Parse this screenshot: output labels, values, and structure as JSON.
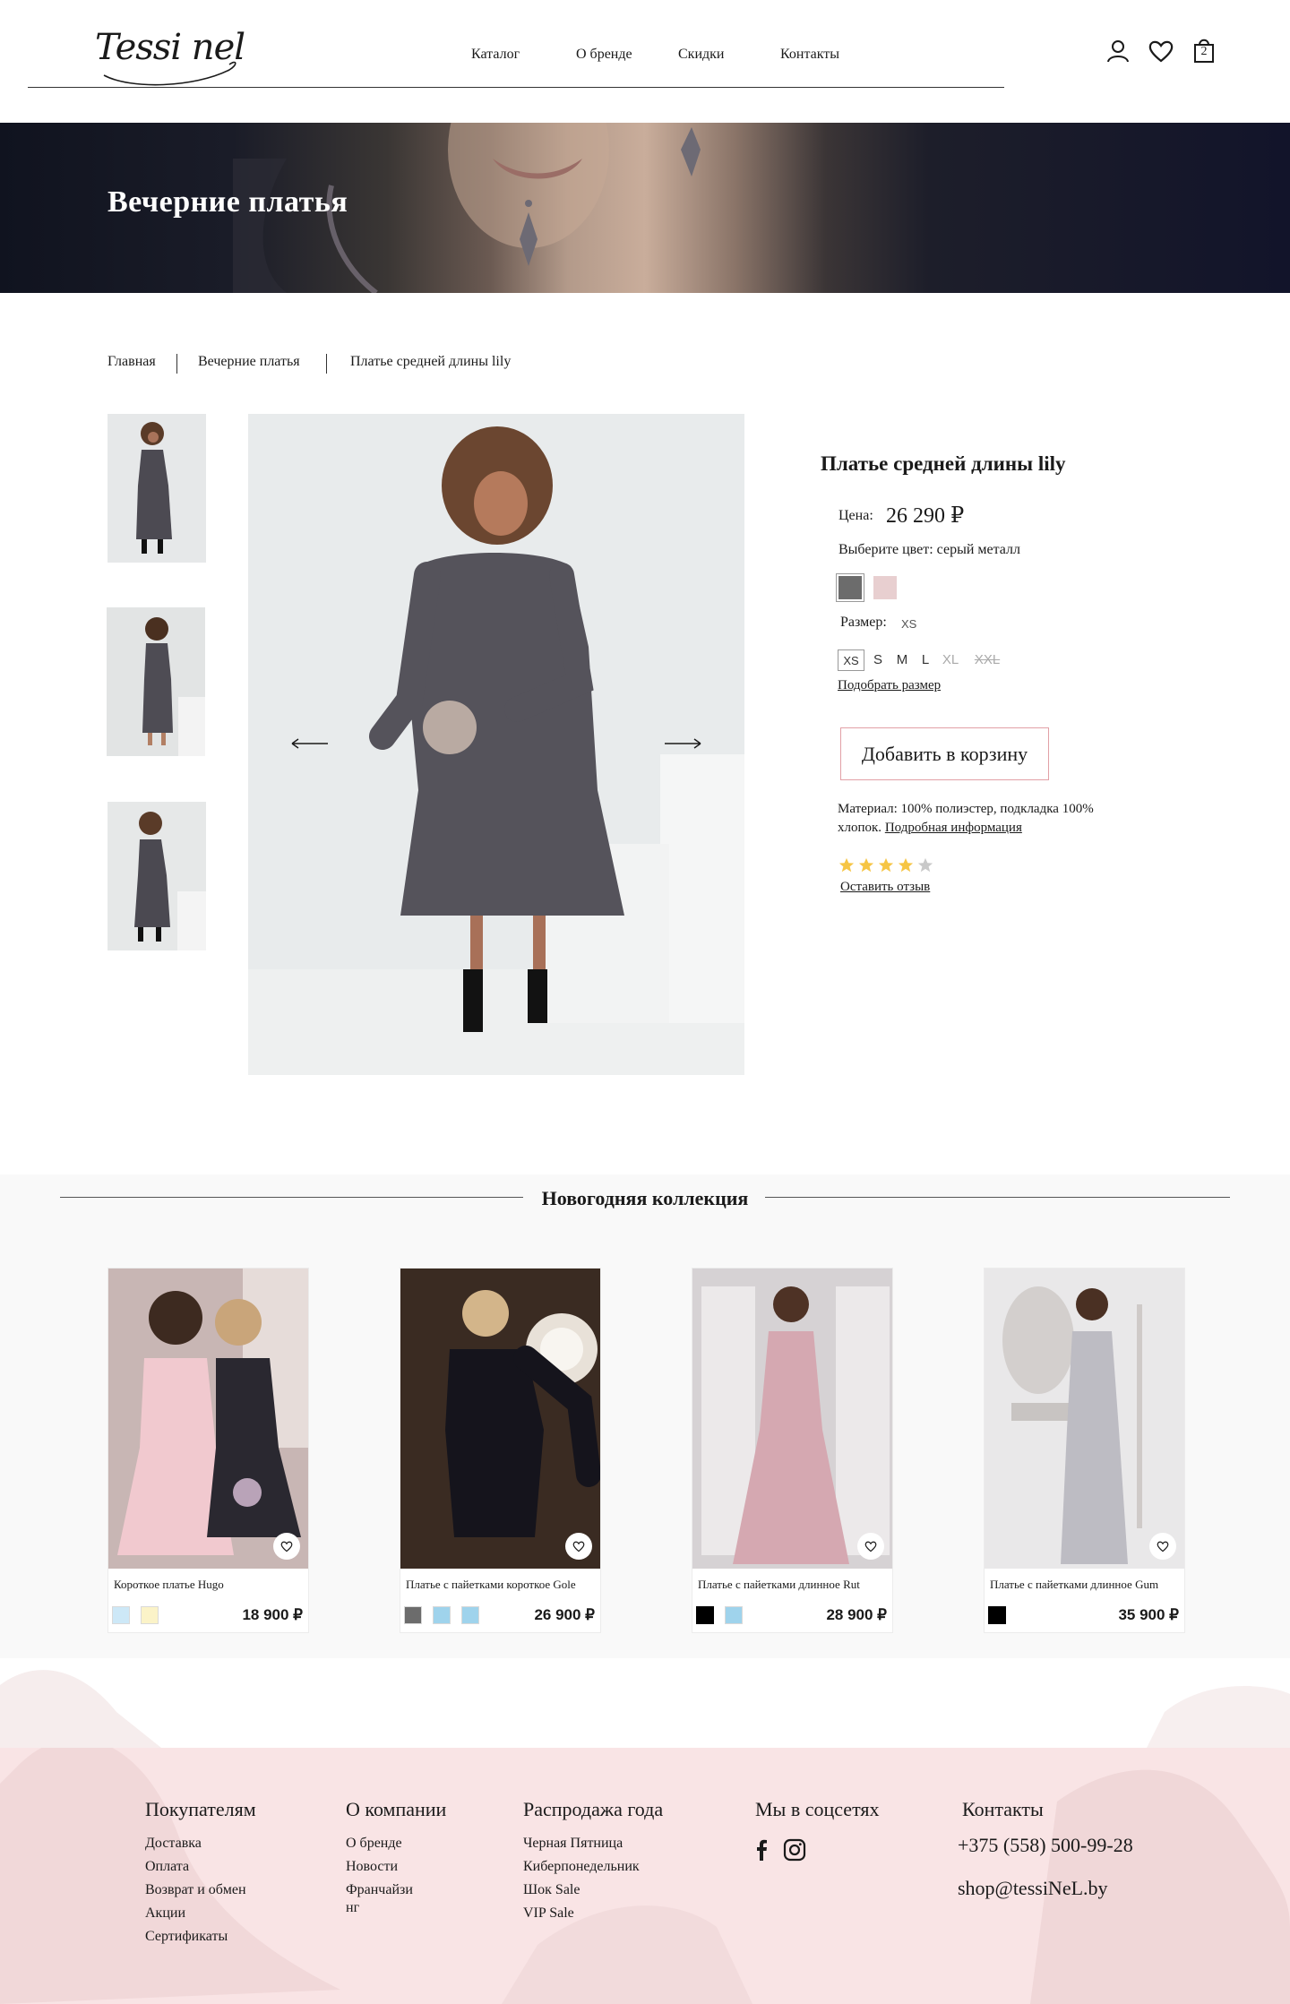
{
  "header": {
    "logo_text": "Tessi nel",
    "nav": [
      {
        "label": "Каталог"
      },
      {
        "label": "О бренде"
      },
      {
        "label": "Скидки"
      },
      {
        "label": "Контакты"
      }
    ],
    "cart_count": "2",
    "icons": [
      "user-icon",
      "heart-icon",
      "cart-icon"
    ]
  },
  "hero": {
    "title": "Вечерние платья"
  },
  "breadcrumb": [
    {
      "label": "Главная"
    },
    {
      "label": "Вечерние платья"
    },
    {
      "label": "Платье  средней длины lily"
    }
  ],
  "gallery": {
    "thumbnail_count": 3,
    "prev_icon": "arrow-left-icon",
    "next_icon": "arrow-right-icon"
  },
  "product": {
    "title": "Платье  средней длины lily",
    "price_label": "Цена:",
    "price": "26 290 ₽",
    "color_label": "Выберите цвет: серый металл",
    "colors": [
      {
        "color": "#6c6c6c",
        "selected": true
      },
      {
        "color": "#e8cfd0",
        "selected": false
      }
    ],
    "size_label": "Размер:",
    "size_selected": "XS",
    "sizes": [
      {
        "label": "XS",
        "state": "selected"
      },
      {
        "label": "S",
        "state": "available"
      },
      {
        "label": "M",
        "state": "available"
      },
      {
        "label": "L",
        "state": "available"
      },
      {
        "label": "XL",
        "state": "disabled"
      },
      {
        "label": "XXL",
        "state": "unavailable"
      }
    ],
    "size_guide": "Подобрать размер",
    "add_to_cart": "Добавить в корзину",
    "material_text": "Материал: 100% полиэстер, подкладка 100% хлопок.",
    "material_link": "Подробная информация",
    "rating": 4,
    "rating_max": 5,
    "review_link": "Оставить отзыв"
  },
  "collection": {
    "title": "Новогодняя коллекция",
    "items": [
      {
        "name": "Короткое платье Hugo",
        "price": "18 900 ₽",
        "colors": [
          "#cde8f7",
          "#fbf3c8"
        ]
      },
      {
        "name": "Платье с пайетками короткое Gole",
        "price": "26 900 ₽",
        "colors": [
          "#6c6c6c",
          "#9fd3ec",
          "#9fd3ec"
        ]
      },
      {
        "name": "Платье с пайетками длинное Rut",
        "price": "28 900 ₽",
        "colors": [
          "#000000",
          "#9fd3ec"
        ]
      },
      {
        "name": "Платье с пайетками длинное Gum",
        "price": "35 900 ₽",
        "colors": [
          "#000000"
        ]
      }
    ]
  },
  "footer": {
    "columns": [
      {
        "title": "Покупателям",
        "links": [
          "Доставка",
          "Оплата",
          "Возврат и обмен",
          "Акции",
          "Сертификаты"
        ]
      },
      {
        "title": "О компании",
        "links": [
          "О бренде",
          "Новости",
          "Франчайзи",
          "нг"
        ]
      },
      {
        "title": "Распродажа года",
        "links": [
          "Черная Пятница",
          "Киберпонедельник",
          "Шок Sale",
          "VIP Sale"
        ]
      }
    ],
    "social_title": "Мы в соцсетях",
    "social": [
      "facebook-icon",
      "instagram-icon"
    ],
    "contacts_title": "Контакты",
    "phone": "+375 (558) 500-99-28",
    "email": "shop@tessiNeL.by"
  }
}
